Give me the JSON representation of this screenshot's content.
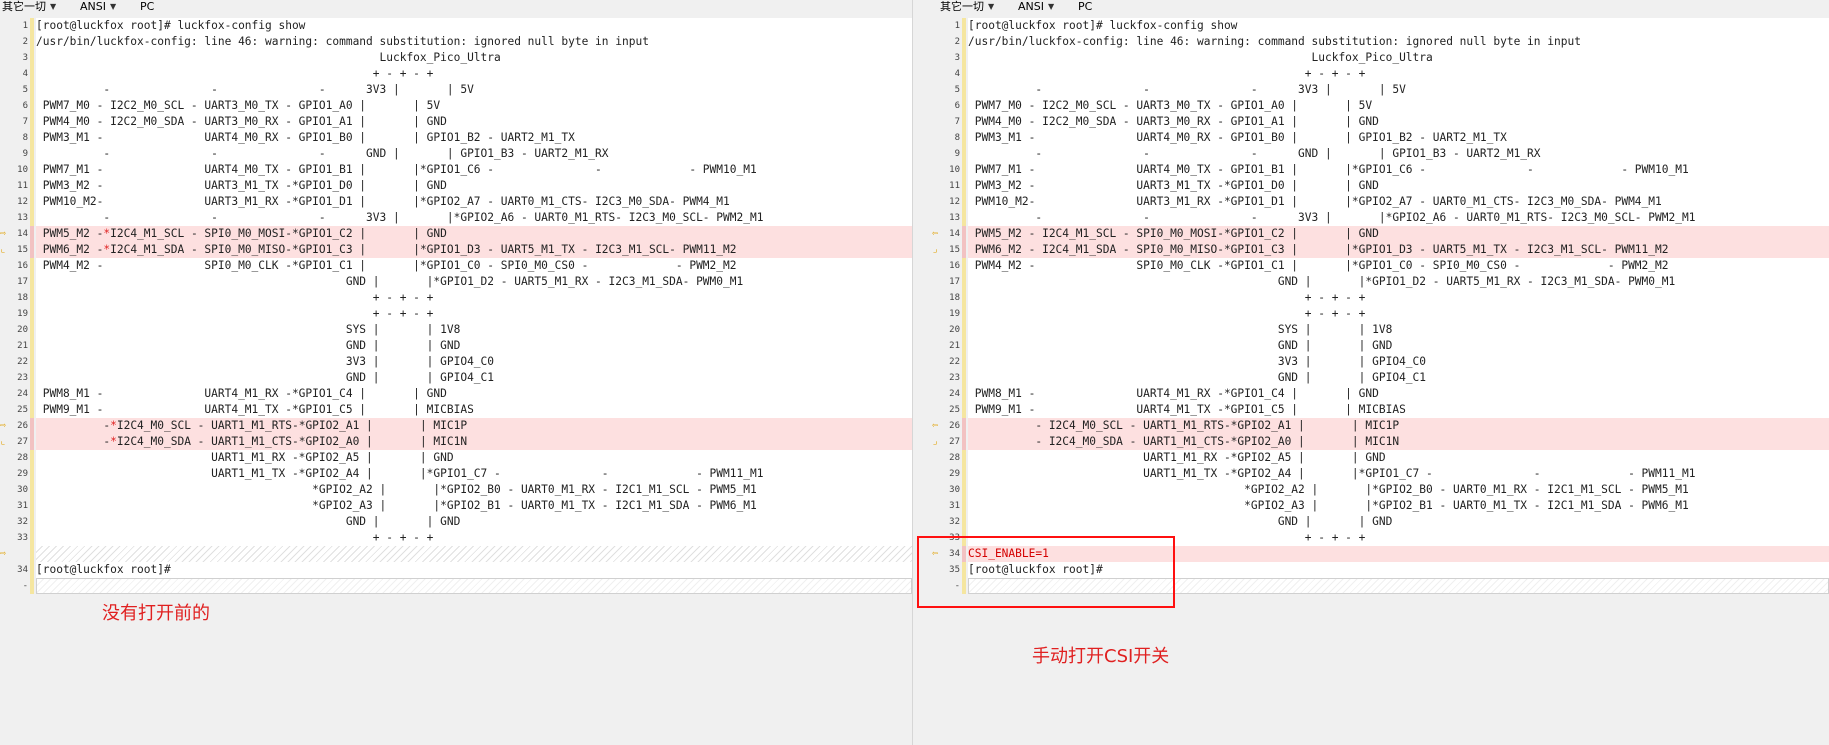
{
  "colors": {
    "accent_red": "#e02020",
    "diff_bg": "#fde0e0",
    "gutter_arrow": "#e0a000"
  },
  "toolbar": {
    "encoding_mode": "其它一切",
    "charset": "ANSI",
    "line_ending": "PC"
  },
  "left": {
    "annotation": "没有打开前的",
    "lines": [
      {
        "n": "1",
        "t": "[root@luckfox root]# luckfox-config show"
      },
      {
        "n": "2",
        "t": "/usr/bin/luckfox-config: line 46: warning: command substitution: ignored null byte in input"
      },
      {
        "n": "3",
        "t": "                                                   Luckfox_Pico_Ultra"
      },
      {
        "n": "4",
        "t": "                                                  + - + - +"
      },
      {
        "n": "5",
        "t": "          -               -               -      3V3 |       | 5V"
      },
      {
        "n": "6",
        "t": " PWM7_M0 - I2C2_M0_SCL - UART3_M0_TX - GPIO1_A0 |       | 5V"
      },
      {
        "n": "7",
        "t": " PWM4_M0 - I2C2_M0_SDA - UART3_M0_RX - GPIO1_A1 |       | GND"
      },
      {
        "n": "8",
        "t": " PWM3_M1 -               UART4_M0_RX - GPIO1_B0 |       | GPIO1_B2 - UART2_M1_TX"
      },
      {
        "n": "9",
        "t": "          -               -               -      GND |       | GPIO1_B3 - UART2_M1_RX"
      },
      {
        "n": "10",
        "t": " PWM7_M1 -               UART4_M0_TX - GPIO1_B1 |       |*GPIO1_C6 -               -             - PWM10_M1"
      },
      {
        "n": "11",
        "t": " PWM3_M2 -               UART3_M1_TX -*GPIO1_D0 |       | GND"
      },
      {
        "n": "12",
        "t": " PWM10_M2-               UART3_M1_RX -*GPIO1_D1 |       |*GPIO2_A7 - UART0_M1_CTS- I2C3_M0_SDA- PWM4_M1"
      },
      {
        "n": "13",
        "t": "          -               -               -      3V3 |       |*GPIO2_A6 - UART0_M1_RTS- I2C3_M0_SCL- PWM2_M1"
      },
      {
        "n": "14",
        "t": " PWM5_M2 -*I2C4_M1_SCL - SPI0_M0_MOSI-*GPIO1_C2 |       | GND",
        "diff": true,
        "mark": "⇨"
      },
      {
        "n": "15",
        "t": " PWM6_M2 -*I2C4_M1_SDA - SPI0_M0_MISO-*GPIO1_C3 |       |*GPIO1_D3 - UART5_M1_TX - I2C3_M1_SCL- PWM11_M2",
        "diff": true,
        "mark": "⌞"
      },
      {
        "n": "16",
        "t": " PWM4_M2 -               SPI0_M0_CLK -*GPIO1_C1 |       |*GPIO1_C0 - SPI0_M0_CS0 -             - PWM2_M2"
      },
      {
        "n": "17",
        "t": "                                              GND |       |*GPIO1_D2 - UART5_M1_RX - I2C3_M1_SDA- PWM0_M1"
      },
      {
        "n": "18",
        "t": "                                                  + - + - +"
      },
      {
        "n": "19",
        "t": "                                                  + - + - +"
      },
      {
        "n": "20",
        "t": "                                              SYS |       | 1V8"
      },
      {
        "n": "21",
        "t": "                                              GND |       | GND"
      },
      {
        "n": "22",
        "t": "                                              3V3 |       | GPIO4_C0"
      },
      {
        "n": "23",
        "t": "                                              GND |       | GPIO4_C1"
      },
      {
        "n": "24",
        "t": " PWM8_M1 -               UART4_M1_RX -*GPIO1_C4 |       | GND"
      },
      {
        "n": "25",
        "t": " PWM9_M1 -               UART4_M1_TX -*GPIO1_C5 |       | MICBIAS"
      },
      {
        "n": "26",
        "t": "          -*I2C4_M0_SCL - UART1_M1_RTS-*GPIO2_A1 |       | MIC1P",
        "diff": true,
        "mark": "⇨"
      },
      {
        "n": "27",
        "t": "          -*I2C4_M0_SDA - UART1_M1_CTS-*GPIO2_A0 |       | MIC1N",
        "diff": true,
        "mark": "⌞"
      },
      {
        "n": "28",
        "t": "                          UART1_M1_RX -*GPIO2_A5 |       | GND"
      },
      {
        "n": "29",
        "t": "                          UART1_M1_TX -*GPIO2_A4 |       |*GPIO1_C7 -               -             - PWM11_M1"
      },
      {
        "n": "30",
        "t": "                                         *GPIO2_A2 |       |*GPIO2_B0 - UART0_M1_RX - I2C1_M1_SCL - PWM5_M1"
      },
      {
        "n": "31",
        "t": "                                         *GPIO2_A3 |       |*GPIO2_B1 - UART0_M1_TX - I2C1_M1_SDA - PWM6_M1"
      },
      {
        "n": "32",
        "t": "                                              GND |       | GND"
      },
      {
        "n": "33",
        "t": "                                                  + - + - +"
      },
      {
        "n": "",
        "t": "",
        "hatch": true,
        "mark": "⇨"
      },
      {
        "n": "34",
        "t": "[root@luckfox root]#"
      },
      {
        "n": "-",
        "t": "",
        "cursor": true
      }
    ]
  },
  "right": {
    "annotation": "手动打开CSI开关",
    "lines": [
      {
        "n": "1",
        "t": "[root@luckfox root]# luckfox-config show"
      },
      {
        "n": "2",
        "t": "/usr/bin/luckfox-config: line 46: warning: command substitution: ignored null byte in input"
      },
      {
        "n": "3",
        "t": "                                                   Luckfox_Pico_Ultra"
      },
      {
        "n": "4",
        "t": "                                                  + - + - +"
      },
      {
        "n": "5",
        "t": "          -               -               -      3V3 |       | 5V"
      },
      {
        "n": "6",
        "t": " PWM7_M0 - I2C2_M0_SCL - UART3_M0_TX - GPIO1_A0 |       | 5V"
      },
      {
        "n": "7",
        "t": " PWM4_M0 - I2C2_M0_SDA - UART3_M0_RX - GPIO1_A1 |       | GND"
      },
      {
        "n": "8",
        "t": " PWM3_M1 -               UART4_M0_RX - GPIO1_B0 |       | GPIO1_B2 - UART2_M1_TX"
      },
      {
        "n": "9",
        "t": "          -               -               -      GND |       | GPIO1_B3 - UART2_M1_RX"
      },
      {
        "n": "10",
        "t": " PWM7_M1 -               UART4_M0_TX - GPIO1_B1 |       |*GPIO1_C6 -               -             - PWM10_M1"
      },
      {
        "n": "11",
        "t": " PWM3_M2 -               UART3_M1_TX -*GPIO1_D0 |       | GND"
      },
      {
        "n": "12",
        "t": " PWM10_M2-               UART3_M1_RX -*GPIO1_D1 |       |*GPIO2_A7 - UART0_M1_CTS- I2C3_M0_SDA- PWM4_M1"
      },
      {
        "n": "13",
        "t": "          -               -               -      3V3 |       |*GPIO2_A6 - UART0_M1_RTS- I2C3_M0_SCL- PWM2_M1"
      },
      {
        "n": "14",
        "t": " PWM5_M2 - I2C4_M1_SCL - SPI0_M0_MOSI-*GPIO1_C2 |       | GND",
        "diff": true,
        "mark": "⇦"
      },
      {
        "n": "15",
        "t": " PWM6_M2 - I2C4_M1_SDA - SPI0_M0_MISO-*GPIO1_C3 |       |*GPIO1_D3 - UART5_M1_TX - I2C3_M1_SCL- PWM11_M2",
        "diff": true,
        "mark": "⌟"
      },
      {
        "n": "16",
        "t": " PWM4_M2 -               SPI0_M0_CLK -*GPIO1_C1 |       |*GPIO1_C0 - SPI0_M0_CS0 -             - PWM2_M2"
      },
      {
        "n": "17",
        "t": "                                              GND |       |*GPIO1_D2 - UART5_M1_RX - I2C3_M1_SDA- PWM0_M1"
      },
      {
        "n": "18",
        "t": "                                                  + - + - +"
      },
      {
        "n": "19",
        "t": "                                                  + - + - +"
      },
      {
        "n": "20",
        "t": "                                              SYS |       | 1V8"
      },
      {
        "n": "21",
        "t": "                                              GND |       | GND"
      },
      {
        "n": "22",
        "t": "                                              3V3 |       | GPIO4_C0"
      },
      {
        "n": "23",
        "t": "                                              GND |       | GPIO4_C1"
      },
      {
        "n": "24",
        "t": " PWM8_M1 -               UART4_M1_RX -*GPIO1_C4 |       | GND"
      },
      {
        "n": "25",
        "t": " PWM9_M1 -               UART4_M1_TX -*GPIO1_C5 |       | MICBIAS"
      },
      {
        "n": "26",
        "t": "          - I2C4_M0_SCL - UART1_M1_RTS-*GPIO2_A1 |       | MIC1P",
        "diff": true,
        "mark": "⇦"
      },
      {
        "n": "27",
        "t": "          - I2C4_M0_SDA - UART1_M1_CTS-*GPIO2_A0 |       | MIC1N",
        "diff": true,
        "mark": "⌟"
      },
      {
        "n": "28",
        "t": "                          UART1_M1_RX -*GPIO2_A5 |       | GND"
      },
      {
        "n": "29",
        "t": "                          UART1_M1_TX -*GPIO2_A4 |       |*GPIO1_C7 -               -             - PWM11_M1"
      },
      {
        "n": "30",
        "t": "                                         *GPIO2_A2 |       |*GPIO2_B0 - UART0_M1_RX - I2C1_M1_SCL - PWM5_M1"
      },
      {
        "n": "31",
        "t": "                                         *GPIO2_A3 |       |*GPIO2_B1 - UART0_M1_TX - I2C1_M1_SDA - PWM6_M1"
      },
      {
        "n": "32",
        "t": "                                              GND |       | GND"
      },
      {
        "n": "33",
        "t": "                                                  + - + - +"
      },
      {
        "n": "34",
        "t": "CSI_ENABLE=1",
        "added": true,
        "mark": "⇦"
      },
      {
        "n": "35",
        "t": "[root@luckfox root]#"
      },
      {
        "n": "-",
        "t": "",
        "cursor": true
      }
    ]
  }
}
